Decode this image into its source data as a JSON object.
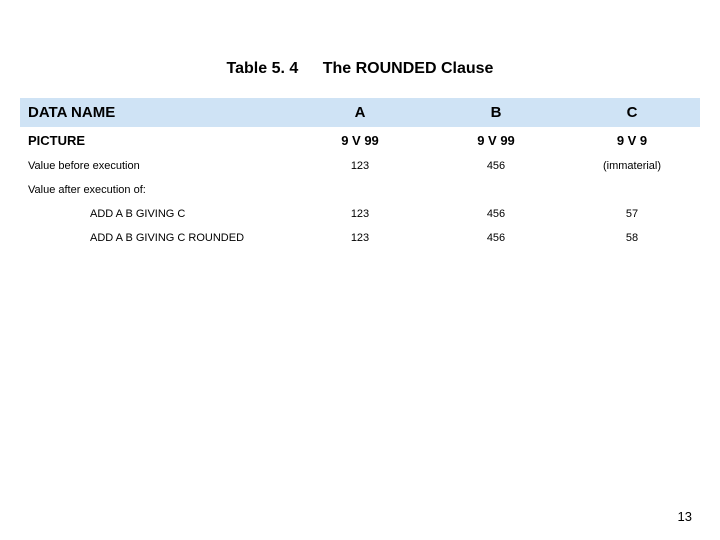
{
  "title": {
    "number": "Table 5. 4",
    "text": "The ROUNDED Clause"
  },
  "header": {
    "label": "DATA NAME",
    "cols": [
      "A",
      "B",
      "C"
    ]
  },
  "picture_row": {
    "label": "PICTURE",
    "values": [
      "9 V 99",
      "9 V 99",
      "9 V 9"
    ]
  },
  "rows": [
    {
      "label": "Value before execution",
      "indent": false,
      "values": [
        "123",
        "456",
        "(immaterial)"
      ]
    }
  ],
  "section_label": "Value after execution of:",
  "section_rows": [
    {
      "label": "ADD A B GIVING C",
      "indent": true,
      "values": [
        "123",
        "456",
        "57"
      ]
    },
    {
      "label": "ADD A B GIVING C ROUNDED",
      "indent": true,
      "values": [
        "123",
        "456",
        "58"
      ]
    }
  ],
  "page_number": "13",
  "chart_data": {
    "type": "table",
    "title": "Table 5.4 The ROUNDED Clause",
    "columns": [
      "DATA NAME",
      "A",
      "B",
      "C"
    ],
    "rows": [
      [
        "PICTURE",
        "9V99",
        "9V99",
        "9V9"
      ],
      [
        "Value before execution",
        123,
        456,
        "(immaterial)"
      ],
      [
        "Value after execution of: ADD A B GIVING C",
        123,
        456,
        57
      ],
      [
        "Value after execution of: ADD A B GIVING C ROUNDED",
        123,
        456,
        58
      ]
    ]
  }
}
